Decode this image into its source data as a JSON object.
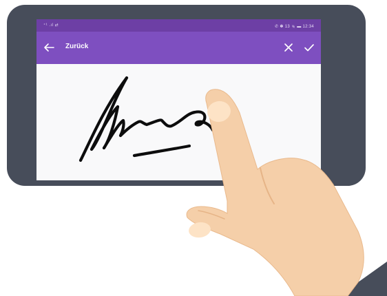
{
  "status_bar": {
    "left": "⁺¹ .ıl ⇄",
    "right": "✆ ✽ 13 ﹪ ▬ 12:34"
  },
  "app_bar": {
    "title": "Zurück",
    "back_icon": "arrow-left-icon",
    "close_icon": "close-icon",
    "confirm_icon": "check-icon"
  },
  "colors": {
    "device_frame": "#474d5a",
    "status_bar": "#6d3fa5",
    "app_bar": "#7e4fc0",
    "canvas": "#f9f9fa",
    "ink": "#0d0d0d",
    "skin": "#f5cfa9",
    "sleeve": "#474d5a"
  }
}
